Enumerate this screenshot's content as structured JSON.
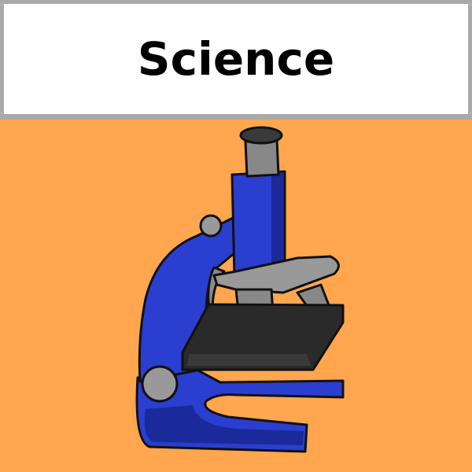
{
  "card": {
    "title": "Science",
    "background_color": "#ffa64f",
    "border_color": "#aaaaaa"
  },
  "illustration": {
    "icon": "microscope-icon"
  }
}
